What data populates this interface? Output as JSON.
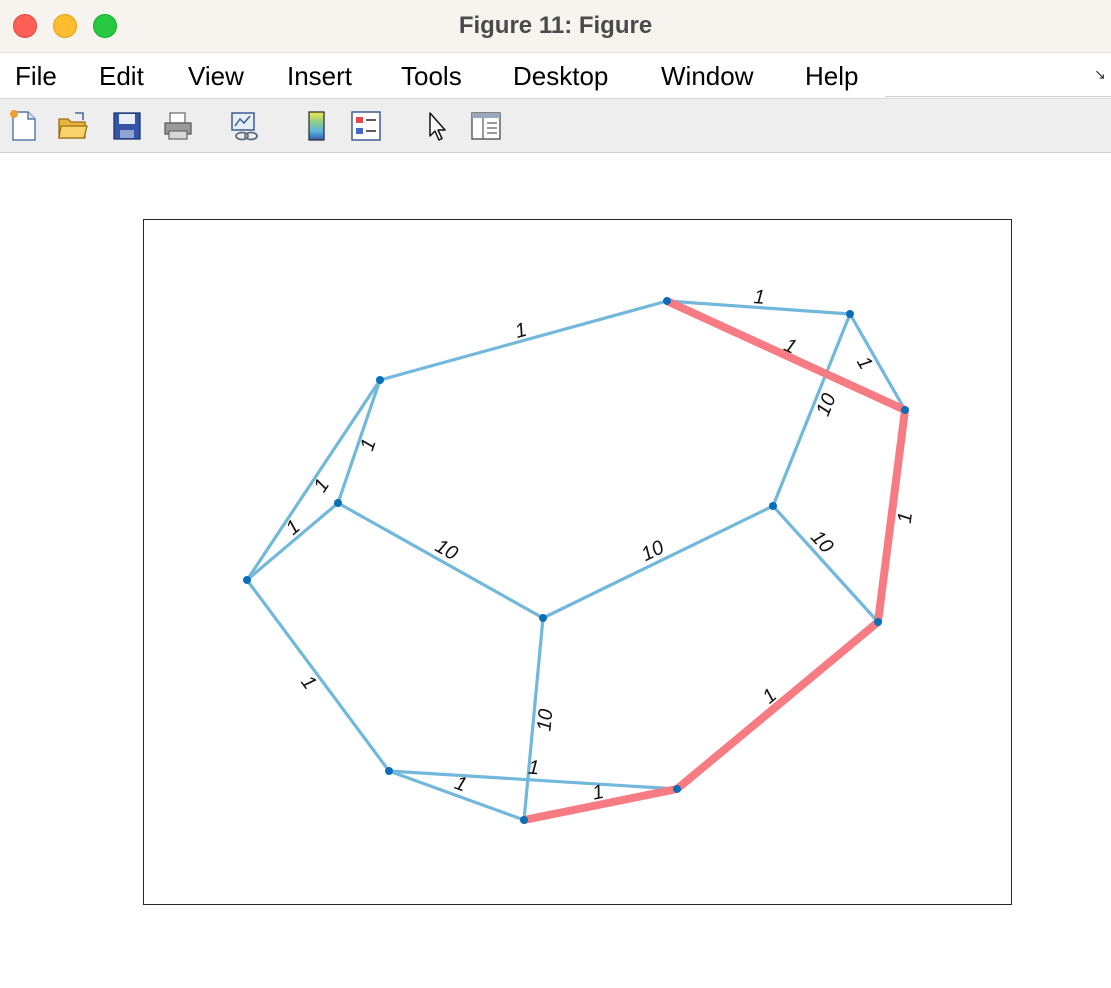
{
  "window": {
    "title": "Figure 11: Figure"
  },
  "menu": {
    "items": [
      "File",
      "Edit",
      "View",
      "Insert",
      "Tools",
      "Desktop",
      "Window",
      "Help"
    ]
  },
  "toolbar": {
    "icons": [
      "new-figure-icon",
      "open-file-icon",
      "save-icon",
      "print-icon",
      "link-plot-icon",
      "colorbar-icon",
      "legend-icon",
      "pointer-icon",
      "property-inspector-icon"
    ]
  },
  "colors": {
    "edge": "#72b7dc",
    "highlight": "#f77b82",
    "node": "#0b6fb7"
  },
  "chart_data": {
    "type": "graph",
    "nodes": [
      "n1",
      "n2",
      "n3",
      "n4",
      "n5",
      "n6",
      "n7",
      "n8",
      "n9",
      "n10",
      "n11",
      "n12",
      "n13"
    ],
    "edges": [
      {
        "from": "n2",
        "to": "n7",
        "weight": "1",
        "highlighted": false
      },
      {
        "from": "n7",
        "to": "n8",
        "weight": "1",
        "highlighted": false
      },
      {
        "from": "n7",
        "to": "n9",
        "weight": "1",
        "highlighted": true
      },
      {
        "from": "n8",
        "to": "n9",
        "weight": "1",
        "highlighted": false
      },
      {
        "from": "n8",
        "to": "n6",
        "weight": "10",
        "highlighted": false
      },
      {
        "from": "n9",
        "to": "n10",
        "weight": "1",
        "highlighted": true
      },
      {
        "from": "n6",
        "to": "n10",
        "weight": "10",
        "highlighted": false
      },
      {
        "from": "n2",
        "to": "n3",
        "weight": "1",
        "highlighted": false
      },
      {
        "from": "n2",
        "to": "n1",
        "weight": "1",
        "highlighted": false
      },
      {
        "from": "n1",
        "to": "n3",
        "weight": "1",
        "highlighted": false
      },
      {
        "from": "n3",
        "to": "n4",
        "weight": "10",
        "highlighted": false
      },
      {
        "from": "n4",
        "to": "n6",
        "weight": "10",
        "highlighted": false
      },
      {
        "from": "n1",
        "to": "n5",
        "weight": "1",
        "highlighted": false
      },
      {
        "from": "n4",
        "to": "n12",
        "weight": "10",
        "highlighted": false
      },
      {
        "from": "n5",
        "to": "n12",
        "weight": "1",
        "highlighted": false
      },
      {
        "from": "n5",
        "to": "n11",
        "weight": "1",
        "highlighted": false
      },
      {
        "from": "n12",
        "to": "n11",
        "weight": "1",
        "highlighted": true
      },
      {
        "from": "n11",
        "to": "n10",
        "weight": "1",
        "highlighted": true
      }
    ]
  }
}
